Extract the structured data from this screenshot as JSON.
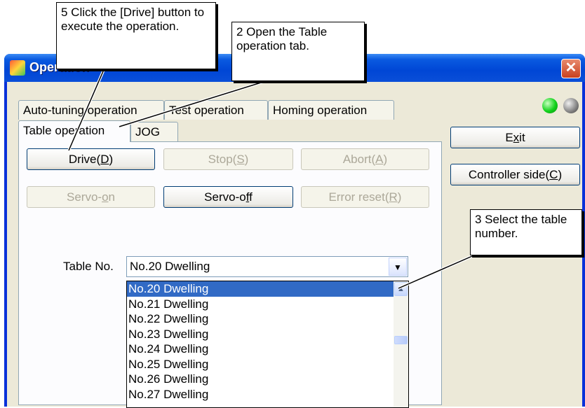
{
  "window": {
    "title": "Operation",
    "close_glyph": "✕"
  },
  "tabs": {
    "row1": [
      "Auto-tuning operation",
      "Test operation",
      "Homing operation"
    ],
    "row2": [
      "Table operation",
      "JOG"
    ]
  },
  "indicators": [
    {
      "name": "green-led",
      "color": "#12d21b"
    },
    {
      "name": "gray-led",
      "color": "#8a8a8a"
    }
  ],
  "buttons": {
    "drive": {
      "label": "Drive(",
      "key": "D",
      "suffix": ")",
      "enabled": true
    },
    "stop": {
      "label": "Stop(",
      "key": "S",
      "suffix": ")",
      "enabled": false
    },
    "abort": {
      "label": "Abort(",
      "key": "A",
      "suffix": ")",
      "enabled": false
    },
    "servo_on": {
      "label": "Servo-",
      "key": "o",
      "suffix": "n",
      "enabled": false
    },
    "servo_off": {
      "label": "Servo-o",
      "key": "f",
      "suffix": "f",
      "enabled": true
    },
    "error_reset": {
      "label": "Error reset(",
      "key": "R",
      "suffix": ")",
      "enabled": false
    },
    "exit": {
      "label": "E",
      "key": "x",
      "suffix": "it",
      "enabled": true
    },
    "controller_side": {
      "label": "Controller side(",
      "key": "C",
      "suffix": ")",
      "enabled": true
    }
  },
  "table_no": {
    "label": "Table No.",
    "selected": "No.20 Dwelling",
    "options": [
      "No.20 Dwelling",
      "No.21 Dwelling",
      "No.22 Dwelling",
      "No.23 Dwelling",
      "No.24 Dwelling",
      "No.25 Dwelling",
      "No.26 Dwelling",
      "No.27 Dwelling"
    ]
  },
  "callouts": {
    "step5": "5 Click the [Drive] button to execute the operation.",
    "step2": "2 Open the Table operation tab.",
    "step3": "3 Select the table number."
  }
}
